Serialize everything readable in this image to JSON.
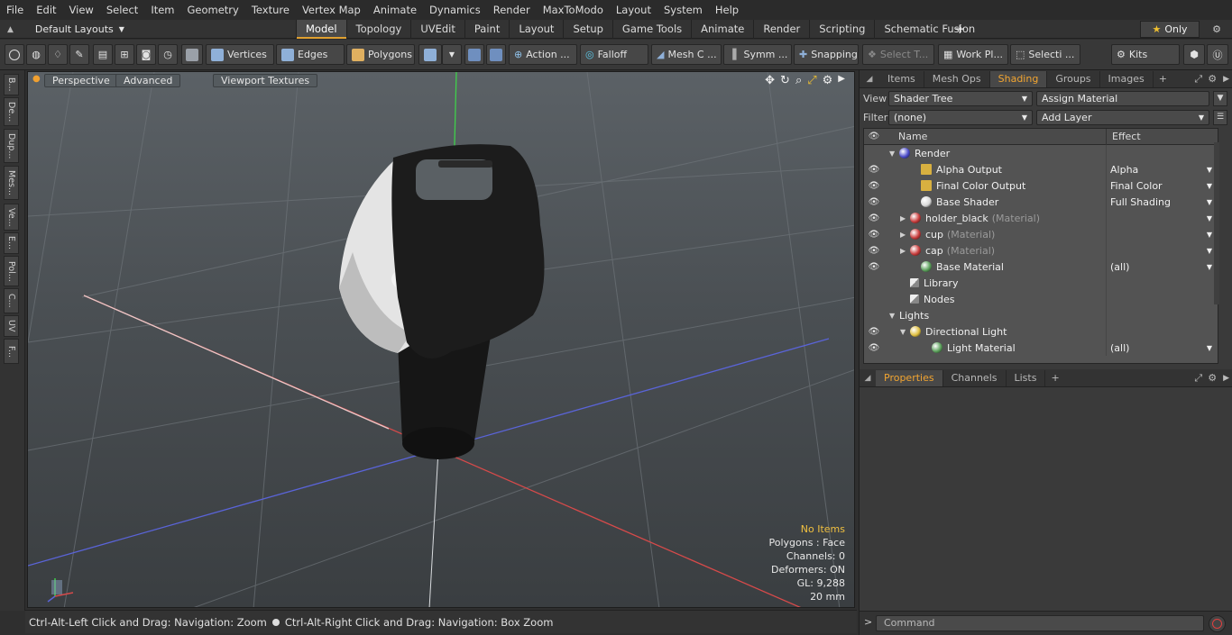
{
  "menu": [
    "File",
    "Edit",
    "View",
    "Select",
    "Item",
    "Geometry",
    "Texture",
    "Vertex Map",
    "Animate",
    "Dynamics",
    "Render",
    "MaxToModo",
    "Layout",
    "System",
    "Help"
  ],
  "layout_select": "Default Layouts",
  "layout_tabs": [
    {
      "label": "Model",
      "active": true
    },
    {
      "label": "Topology"
    },
    {
      "label": "UVEdit"
    },
    {
      "label": "Paint"
    },
    {
      "label": "Layout"
    },
    {
      "label": "Setup"
    },
    {
      "label": "Game Tools"
    },
    {
      "label": "Animate"
    },
    {
      "label": "Render"
    },
    {
      "label": "Scripting"
    },
    {
      "label": "Schematic Fusion"
    }
  ],
  "only_label": "Only",
  "toolbar": {
    "vertices": "Vertices",
    "edges": "Edges",
    "polygons": "Polygons",
    "action": "Action ...",
    "falloff": "Falloff",
    "mesh_c": "Mesh C ...",
    "symm": "Symm ...",
    "snapping": "Snapping",
    "select_t": "Select T...",
    "work_pl": "Work Pl...",
    "selecti": "Selecti ...",
    "kits": "Kits"
  },
  "left_tabs": [
    "B...",
    "De...",
    "Dup...",
    "Mes...",
    "Ve...",
    "E...",
    "Pol...",
    "C...",
    "UV",
    "F..."
  ],
  "viewport": {
    "tabs": [
      "Perspective",
      "Advanced",
      "Viewport Textures"
    ],
    "info": {
      "no_items": "No Items",
      "polygons": "Polygons : Face",
      "channels": "Channels: 0",
      "deformers": "Deformers: ON",
      "gl": "GL: 9,288",
      "scale": "20 mm"
    }
  },
  "status_text_1": "Ctrl-Alt-Left Click and Drag: Navigation: Zoom",
  "status_text_2": "Ctrl-Alt-Right Click and Drag: Navigation: Box Zoom",
  "panel": {
    "tabs": [
      {
        "label": "Items"
      },
      {
        "label": "Mesh Ops"
      },
      {
        "label": "Shading",
        "active": true
      },
      {
        "label": "Groups"
      },
      {
        "label": "Images"
      }
    ],
    "view_label": "View",
    "view_value": "Shader Tree",
    "assign_material": "Assign Material",
    "filter_label": "Filter",
    "filter_value": "(none)",
    "add_layer": "Add Layer",
    "col_name": "Name",
    "col_effect": "Effect",
    "tree": [
      {
        "name": "Render",
        "effect": "",
        "indent": 0,
        "fold": "▼",
        "eye": false,
        "icon": "#4a4ac8",
        "shape": "sphere"
      },
      {
        "name": "Alpha Output",
        "effect": "Alpha",
        "indent": 2,
        "fold": "",
        "eye": true,
        "icon": "#d8b040",
        "shape": "square",
        "dd": true
      },
      {
        "name": "Final Color Output",
        "effect": "Final Color",
        "indent": 2,
        "fold": "",
        "eye": true,
        "icon": "#d8b040",
        "shape": "square",
        "dd": true
      },
      {
        "name": "Base Shader",
        "effect": "Full Shading",
        "indent": 2,
        "fold": "",
        "eye": true,
        "icon": "#d8d8d8",
        "shape": "sphere",
        "dd": true
      },
      {
        "name": "holder_black",
        "sub": "(Material)",
        "effect": "",
        "indent": 1,
        "fold": "▶",
        "eye": true,
        "icon": "#c83a3a",
        "shape": "sphere",
        "dd": true
      },
      {
        "name": "cup",
        "sub": "(Material)",
        "effect": "",
        "indent": 1,
        "fold": "▶",
        "eye": true,
        "icon": "#c83a3a",
        "shape": "sphere",
        "dd": true
      },
      {
        "name": "cap",
        "sub": "(Material)",
        "effect": "",
        "indent": 1,
        "fold": "▶",
        "eye": true,
        "icon": "#c83a3a",
        "shape": "sphere",
        "dd": true
      },
      {
        "name": "Base Material",
        "effect": "(all)",
        "indent": 2,
        "fold": "",
        "eye": true,
        "icon": "#5aa05a",
        "shape": "sphere",
        "dd": true
      },
      {
        "name": "Library",
        "effect": "",
        "indent": 1,
        "fold": "",
        "eye": false,
        "icon": "#cfcfcf",
        "shape": "folder"
      },
      {
        "name": "Nodes",
        "effect": "",
        "indent": 1,
        "fold": "",
        "eye": false,
        "icon": "#cfcfcf",
        "shape": "folder"
      },
      {
        "name": "Lights",
        "effect": "",
        "indent": 0,
        "fold": "▼",
        "eye": false,
        "icon": "",
        "shape": "none"
      },
      {
        "name": "Directional Light",
        "effect": "",
        "indent": 1,
        "fold": "▼",
        "eye": true,
        "icon": "#e0c040",
        "shape": "sphere"
      },
      {
        "name": "Light Material",
        "effect": "(all)",
        "indent": 3,
        "fold": "",
        "eye": true,
        "icon": "#5aa05a",
        "shape": "sphere",
        "dd": true
      }
    ],
    "bottom_tabs": [
      {
        "label": "Properties",
        "active": true
      },
      {
        "label": "Channels"
      },
      {
        "label": "Lists"
      }
    ],
    "command_placeholder": "Command"
  }
}
